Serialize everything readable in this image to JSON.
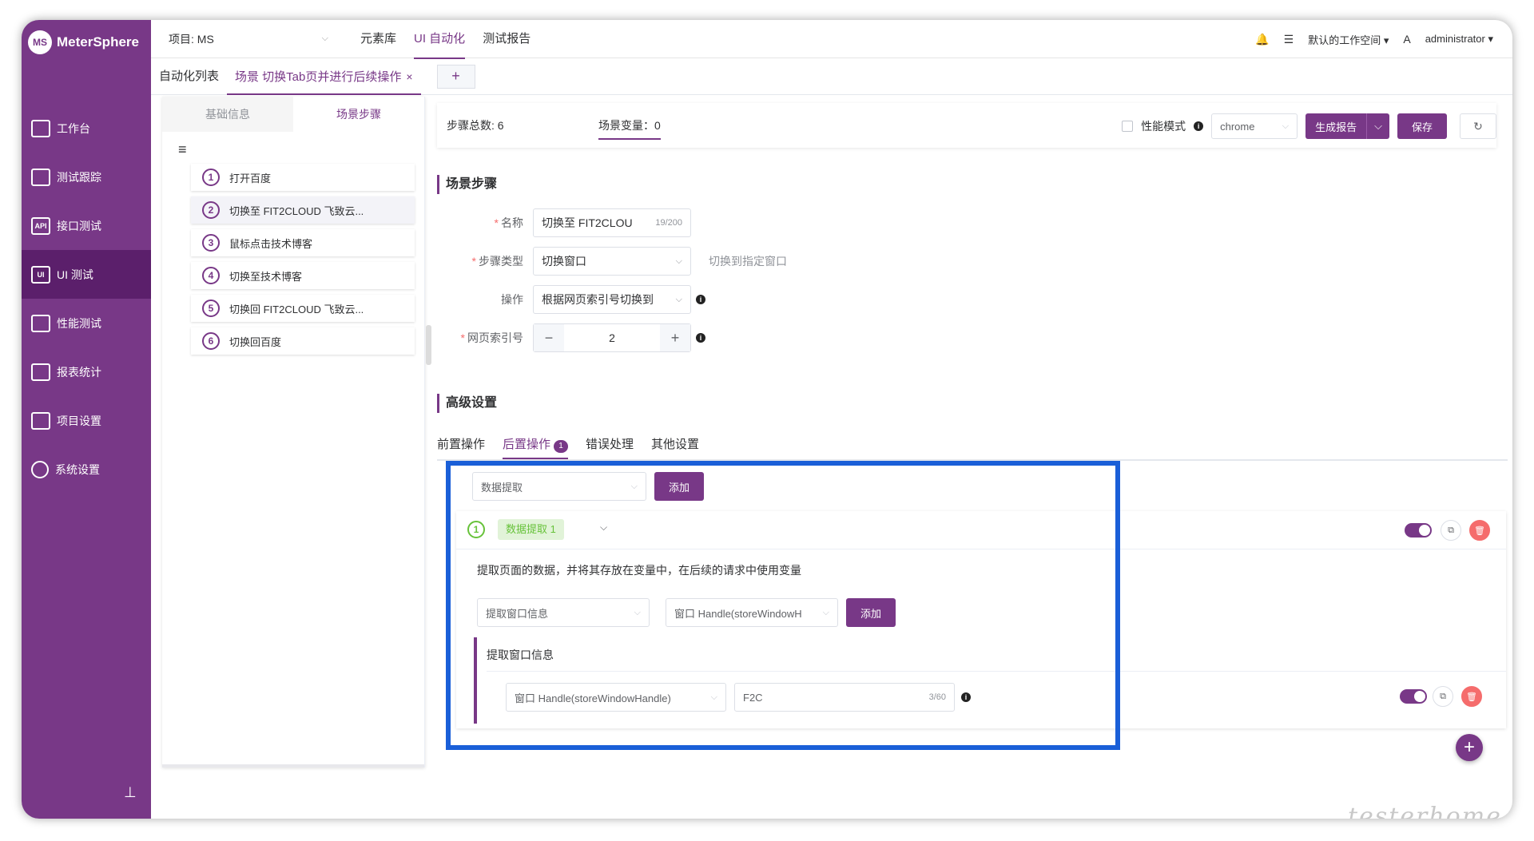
{
  "app": {
    "logo_mark": "MS",
    "name": "MeterSphere"
  },
  "sidebar": {
    "items": [
      {
        "label": "工作台",
        "icon": "monitor-icon",
        "glyph": ""
      },
      {
        "label": "测试跟踪",
        "icon": "clipboard-icon",
        "glyph": ""
      },
      {
        "label": "接口测试",
        "icon": "api-icon",
        "glyph": "API"
      },
      {
        "label": "UI 测试",
        "icon": "ui-icon",
        "glyph": "UI",
        "active": true
      },
      {
        "label": "性能测试",
        "icon": "chart-icon",
        "glyph": ""
      },
      {
        "label": "报表统计",
        "icon": "report-icon",
        "glyph": ""
      },
      {
        "label": "项目设置",
        "icon": "folder-icon",
        "glyph": ""
      },
      {
        "label": "系统设置",
        "icon": "gear-icon",
        "glyph": ""
      }
    ],
    "pin_glyph": "⊥"
  },
  "header": {
    "project": "项目: MS",
    "caret": "⌵",
    "nav": [
      "元素库",
      "UI 自动化",
      "测试报告"
    ],
    "active_nav": "UI 自动化",
    "bell": "🔔",
    "list_glyph": "☰",
    "workspace": "默认的工作空间",
    "lang_glyph": "A",
    "user": "administrator",
    "dropdown": "▾"
  },
  "tabs": {
    "list_tab": "自动化列表",
    "scene_tab": "场景 切换Tab页并进行后续操作",
    "close_glyph": "×",
    "add_glyph": "+"
  },
  "left_panel": {
    "tab_basic": "基础信息",
    "tab_steps": "场景步骤",
    "menu_glyph": "≡",
    "steps": [
      {
        "num": "1",
        "label": "打开百度"
      },
      {
        "num": "2",
        "label": "切换至 FIT2CLOUD 飞致云..."
      },
      {
        "num": "3",
        "label": "鼠标点击技术博客"
      },
      {
        "num": "4",
        "label": "切换至技术博客"
      },
      {
        "num": "5",
        "label": "切换回 FIT2CLOUD 飞致云..."
      },
      {
        "num": "6",
        "label": "切换回百度"
      }
    ]
  },
  "infobar": {
    "step_total": "步骤总数: 6",
    "scene_var": "场景变量：0",
    "perf_mode": "性能模式",
    "info_glyph": "i",
    "browser": "chrome",
    "gen_report": "生成报告",
    "save": "保存",
    "refresh_glyph": "↻"
  },
  "scene_steps": {
    "title": "场景步骤",
    "required_mark": "*",
    "name_label": "名称",
    "name_value": "切换至 FIT2CLOU",
    "name_counter": "19/200",
    "type_label": "步骤类型",
    "type_value": "切换窗口",
    "type_hint": "切换到指定窗口",
    "op_label": "操作",
    "op_value": "根据网页索引号切换到",
    "index_label": "网页索引号",
    "index_value": "2",
    "minus_glyph": "−",
    "plus_glyph": "+"
  },
  "advanced": {
    "title": "高级设置",
    "tabs": [
      "前置操作",
      "后置操作",
      "错误处理",
      "其他设置"
    ],
    "post_badge": "1",
    "extract_select": "数据提取",
    "add": "添加"
  },
  "extract_card": {
    "num": "1",
    "tag": "数据提取 1",
    "description": "提取页面的数据，并将其存放在变量中，在后续的请求中使用变量",
    "type_select": "提取窗口信息",
    "handle_select": "窗口 Handle(storeWindowH",
    "add": "添加",
    "sub_title": "提取窗口信息",
    "row_select": "窗口 Handle(storeWindowHandle)",
    "row_value": "F2C",
    "row_counter": "3/60",
    "copy_glyph": "⧉",
    "delete_glyph": "🗑"
  },
  "fab_glyph": "+",
  "watermark": "testerhome.com",
  "colors": {
    "brand": "#783887",
    "highlight": "#1a5fd8",
    "success": "#67c23a",
    "danger": "#f56c6c"
  }
}
